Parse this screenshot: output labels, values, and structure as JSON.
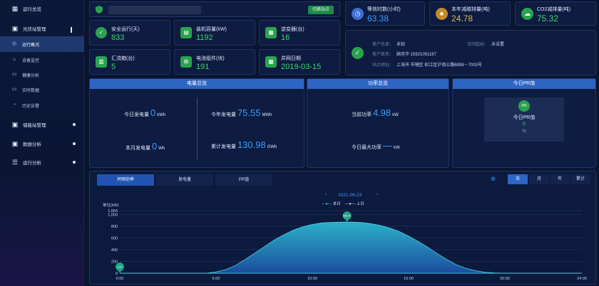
{
  "sidebar": {
    "items": [
      {
        "label": "运行总览",
        "icon": "dashboard-icon"
      },
      {
        "label": "光伏站管理",
        "icon": "solar-icon"
      },
      {
        "label": "运行概况",
        "icon": "target-icon"
      },
      {
        "label": "设备监控",
        "icon": "monitor-icon"
      },
      {
        "label": "健康分析",
        "icon": "health-icon"
      },
      {
        "label": "实时数据",
        "icon": "data-icon"
      },
      {
        "label": "历史告警",
        "icon": "alarm-icon"
      },
      {
        "label": "储能站管理",
        "icon": "battery-icon"
      },
      {
        "label": "数据分析",
        "icon": "analysis-icon"
      },
      {
        "label": "运行分析",
        "icon": "chart-icon"
      }
    ]
  },
  "site": {
    "switch_label": "切换站点"
  },
  "stats": [
    {
      "label": "安全运行(天)",
      "value": "833"
    },
    {
      "label": "装机容量(kW)",
      "value": "1192"
    },
    {
      "label": "逆变器(台)",
      "value": "16"
    },
    {
      "label": "汇流箱(台)",
      "value": "5"
    },
    {
      "label": "电池组件(块)",
      "value": "191"
    },
    {
      "label": "并网日期",
      "value": "2019-03-15"
    }
  ],
  "top_kpis": [
    {
      "label": "等效时数(小时)",
      "value": "63.38",
      "color": "#3a9bff"
    },
    {
      "label": "本年减碳排量(吨)",
      "value": "24.78",
      "color": "#e0b94a"
    },
    {
      "label": "CO2减排量(吨)",
      "value": "75.32",
      "color": "#3fd56b"
    }
  ],
  "customer": {
    "info_key": "客户信息：",
    "info_val": "未知",
    "contract_key": "合同起始：",
    "contract_val": "未设置",
    "contact_key": "客户联系：",
    "contact_val": "顾月华 15921051187",
    "addr_key": "站点地址：",
    "addr_val": "上海市 市辖区 松江区沪南公路6998－7000号"
  },
  "energy": {
    "title": "电量总览",
    "today_label": "今日发电量",
    "today_value": "0",
    "today_unit": "kWh",
    "month_label": "本月发电量",
    "month_value": "0",
    "month_unit": "Wh",
    "year_label": "今年发电量",
    "year_value": "75.55",
    "year_unit": "MWh",
    "total_label": "累计发电量",
    "total_value": "130.98",
    "total_unit": "GWh"
  },
  "power": {
    "title": "功率总览",
    "current_label": "当前功率",
    "current_value": "4.98",
    "current_unit": "kW",
    "max_label": "今日最大功率",
    "max_value": "—",
    "max_unit": "kW"
  },
  "pr": {
    "title": "今日PR值",
    "icon_text": "PR",
    "label": "今日PR值",
    "value": "0",
    "unit": "%"
  },
  "chart_tabs": [
    "并网功率",
    "发电量",
    "PR值"
  ],
  "period_buttons": [
    "天",
    "月",
    "年",
    "累计"
  ],
  "chart_data": {
    "type": "area",
    "date": "2021-06-23",
    "legend": [
      "本日",
      "上日"
    ],
    "ylabel": "单位(kW)",
    "ylim": [
      0,
      1064
    ],
    "y_ticks": [
      "1,064",
      "1,000",
      "800",
      "600",
      "400",
      "200",
      "0"
    ],
    "x_ticks": [
      "0:00",
      "5:00",
      "10:00",
      "15:00",
      "20:00",
      "24:00"
    ],
    "xlim": [
      0,
      24
    ],
    "x": [
      0,
      4.5,
      5,
      5.5,
      6,
      6.5,
      7,
      7.5,
      8,
      8.5,
      9,
      9.5,
      10,
      10.5,
      11,
      11.5,
      12,
      12.5,
      13,
      13.5,
      14,
      14.5,
      15,
      15.5,
      16,
      16.5,
      17,
      17.5,
      18,
      18.5,
      19,
      19.5,
      20,
      24
    ],
    "series": [
      {
        "name": "本日",
        "values": [
          0,
          0,
          20,
          60,
          130,
          230,
          340,
          450,
          560,
          650,
          730,
          790,
          830,
          855,
          865,
          868,
          868,
          862,
          845,
          815,
          770,
          710,
          630,
          540,
          440,
          330,
          230,
          140,
          80,
          40,
          15,
          5,
          0,
          0
        ]
      }
    ],
    "peak_marker": {
      "x": 11.8,
      "y": 868,
      "label": "868.04"
    },
    "start_marker": {
      "x": 0,
      "y": 0,
      "label": "0.00"
    }
  }
}
